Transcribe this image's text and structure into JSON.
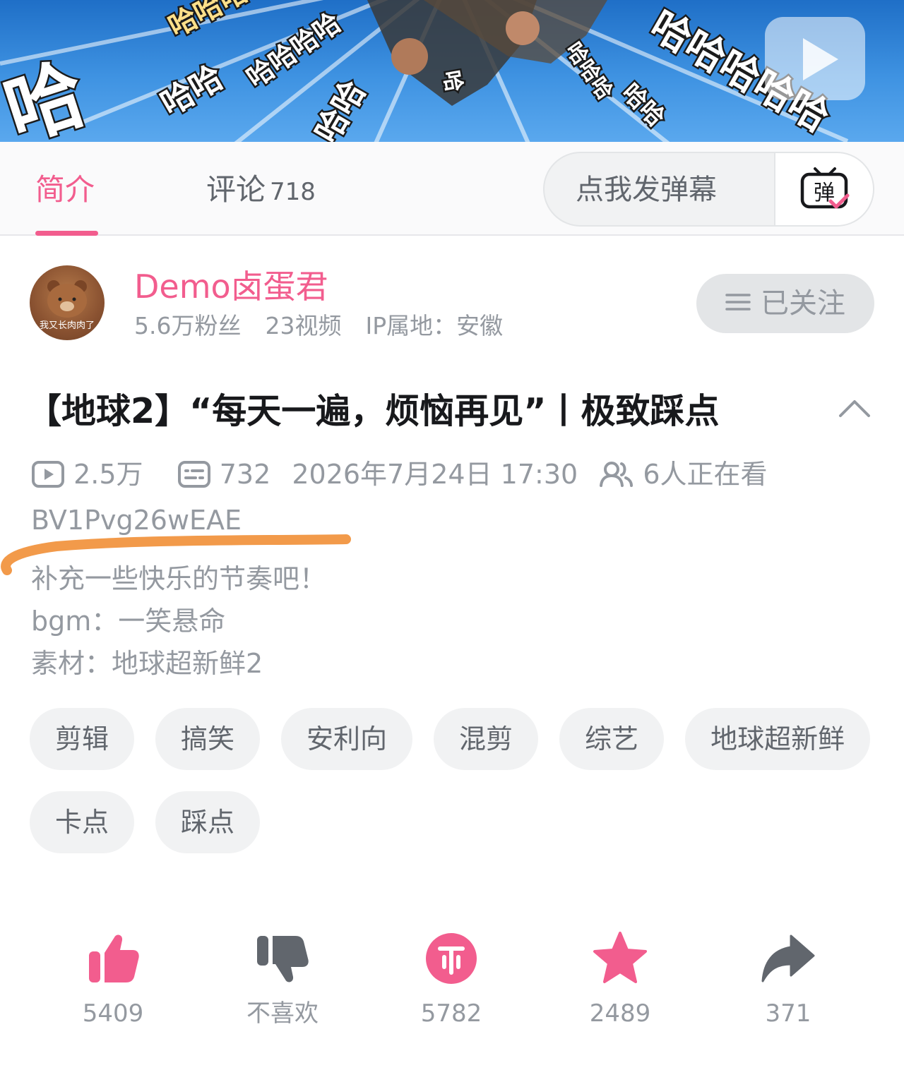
{
  "player": {
    "overlay_text": [
      "哈",
      "哈哈",
      "哈哈哈",
      "哈哈哈哈",
      "哈哈",
      "哈",
      "哈哈哈",
      "哈哈",
      "哈哈哈哈哈"
    ]
  },
  "tabs": {
    "intro": "简介",
    "comments": "评论",
    "comments_count": "718",
    "danmaku_placeholder": "点我发弹幕",
    "danmaku_button_glyph": "弹"
  },
  "uploader": {
    "avatar_text": "我又长肉肉了",
    "name": "Demo卤蛋君",
    "fans": "5.6万粉丝",
    "videos": "23视频",
    "ip_location": "IP属地：安徽",
    "follow_label": "已关注"
  },
  "video": {
    "title": "【地球2】“每天一遍，烦恼再见”丨极致踩点",
    "views": "2.5万",
    "danmaku_count": "732",
    "publish_time": "2026年7月24日 17:30",
    "watching_now": "6人正在看",
    "bvid": "BV1Pvg26wEAE",
    "description": "补充一些快乐的节奏吧！\nbgm：一笑悬命\n素材：地球超新鲜2"
  },
  "tags": [
    "剪辑",
    "搞笑",
    "安利向",
    "混剪",
    "综艺",
    "地球超新鲜",
    "卡点",
    "踩点"
  ],
  "actions": {
    "like": "5409",
    "dislike": "不喜欢",
    "coin": "5782",
    "favorite": "2489",
    "share": "371"
  },
  "colors": {
    "accent_pink": "#f25d8e",
    "text_gray": "#9499a0",
    "dark_gray": "#61666d",
    "annotation_orange": "#f29a4a"
  }
}
